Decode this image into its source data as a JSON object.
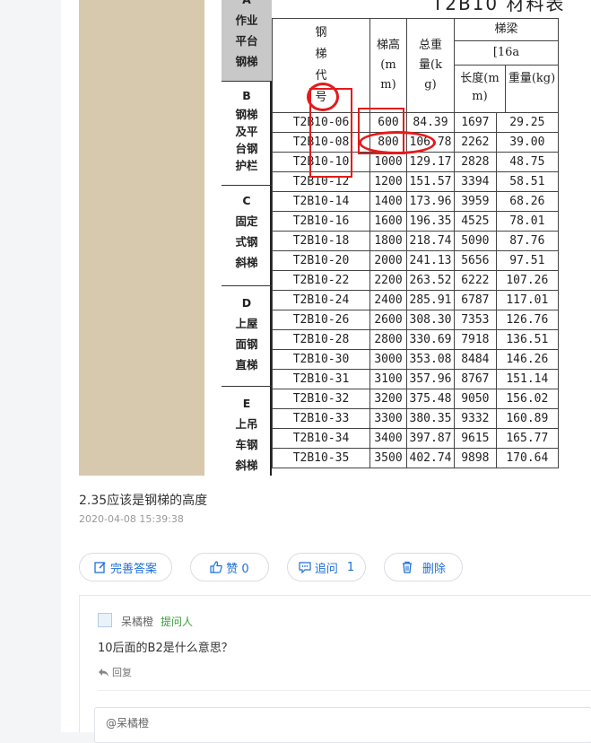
{
  "sheet": {
    "title": "T2B10 材料表",
    "categories": [
      {
        "letter": "A",
        "lines": [
          "作业",
          "平台",
          "钢梯"
        ]
      },
      {
        "letter": "B",
        "lines": [
          "钢梯",
          "及平",
          "台钢",
          "护栏"
        ]
      },
      {
        "letter": "C",
        "lines": [
          "固定",
          "式钢",
          "斜梯"
        ]
      },
      {
        "letter": "D",
        "lines": [
          "上屋",
          "面钢",
          "直梯"
        ]
      },
      {
        "letter": "E",
        "lines": [
          "上吊",
          "车钢",
          "斜梯"
        ]
      }
    ],
    "headers": {
      "code": "钢梯代号",
      "height": "梯高(mm)",
      "weight": "总重量(kg)",
      "beam": "梯梁",
      "beam_spec": "[16a",
      "length": "长度(mm)",
      "beam_weight": "重量(kg)"
    },
    "rows": [
      [
        "T2B10-06",
        "600",
        "84.39",
        "1697",
        "29.25"
      ],
      [
        "T2B10-08",
        "800",
        "106.78",
        "2262",
        "39.00"
      ],
      [
        "T2B10-10",
        "1000",
        "129.17",
        "2828",
        "48.75"
      ],
      [
        "T2B10-12",
        "1200",
        "151.57",
        "3394",
        "58.51"
      ],
      [
        "T2B10-14",
        "1400",
        "173.96",
        "3959",
        "68.26"
      ],
      [
        "T2B10-16",
        "1600",
        "196.35",
        "4525",
        "78.01"
      ],
      [
        "T2B10-18",
        "1800",
        "218.74",
        "5090",
        "87.76"
      ],
      [
        "T2B10-20",
        "2000",
        "241.13",
        "5656",
        "97.51"
      ],
      [
        "T2B10-22",
        "2200",
        "263.52",
        "6222",
        "107.26"
      ],
      [
        "T2B10-24",
        "2400",
        "285.91",
        "6787",
        "117.01"
      ],
      [
        "T2B10-26",
        "2600",
        "308.30",
        "7353",
        "126.76"
      ],
      [
        "T2B10-28",
        "2800",
        "330.69",
        "7918",
        "136.51"
      ],
      [
        "T2B10-30",
        "3000",
        "353.08",
        "8484",
        "146.26"
      ],
      [
        "T2B10-31",
        "3100",
        "357.96",
        "8767",
        "151.14"
      ],
      [
        "T2B10-32",
        "3200",
        "375.48",
        "9050",
        "156.02"
      ],
      [
        "T2B10-33",
        "3300",
        "380.35",
        "9332",
        "160.89"
      ],
      [
        "T2B10-34",
        "3400",
        "397.87",
        "9615",
        "165.77"
      ],
      [
        "T2B10-35",
        "3500",
        "402.74",
        "9898",
        "170.64"
      ]
    ]
  },
  "answer": {
    "caption": "2.35应该是钢梯的高度",
    "timestamp": "2020-04-08 15:39:38"
  },
  "actions": {
    "improve_label": "完善答案",
    "like_label": "赞 0",
    "followup_label": "追问",
    "followup_count": "1",
    "delete_label": "删除"
  },
  "comment": {
    "user": "呆橘橙",
    "role": "提问人",
    "text": "10后面的B2是什么意思？",
    "reply_label": "回复",
    "input_value": "@呆橘橙"
  },
  "colors": {
    "accent": "#1e6fd9",
    "role": "#3a9d3a",
    "annotation": "#e31b1b"
  }
}
